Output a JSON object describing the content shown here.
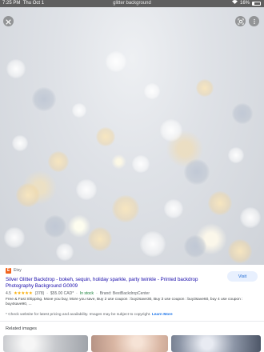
{
  "status_bar": {
    "time": "7:25 PM",
    "date": "Thu Oct 1",
    "url": "glitter background",
    "battery": "16%"
  },
  "viewer": {
    "close_icon": "close-icon",
    "lens_icon": "lens-icon",
    "more_icon": "more-vertical-icon"
  },
  "result": {
    "source": "Etsy",
    "title": "Silver Glitter Backdrop - bokeh, sequin, holiday sparkle, party twinkle - Printed backdrop Photography Background G0009",
    "rating": "4.5",
    "stars": "★★★★★",
    "reviews": "(378)",
    "price": "$55.00 CAD*",
    "stock": "In stock",
    "brand": "Brand: BestBackdropCenter",
    "description": "Free & Fast Shipping. Move you buy, More you save, Buy 2 use coupon : buy2save30, Buy 3 use coupon : buy3save60, buy 4 use coupon : buy4save90, ...",
    "visit_label": "Visit",
    "disclaimer": "* Check website for latest pricing and availability. Images may be subject to copyright.",
    "learn_more": "Learn More"
  },
  "related": {
    "heading": "Related images"
  },
  "colors": {
    "link": "#1a0dab",
    "visit_bg": "#e8f0fe",
    "visit_text": "#1967d2",
    "in_stock": "#188038",
    "star": "#f9ab00",
    "etsy": "#f1641e"
  }
}
